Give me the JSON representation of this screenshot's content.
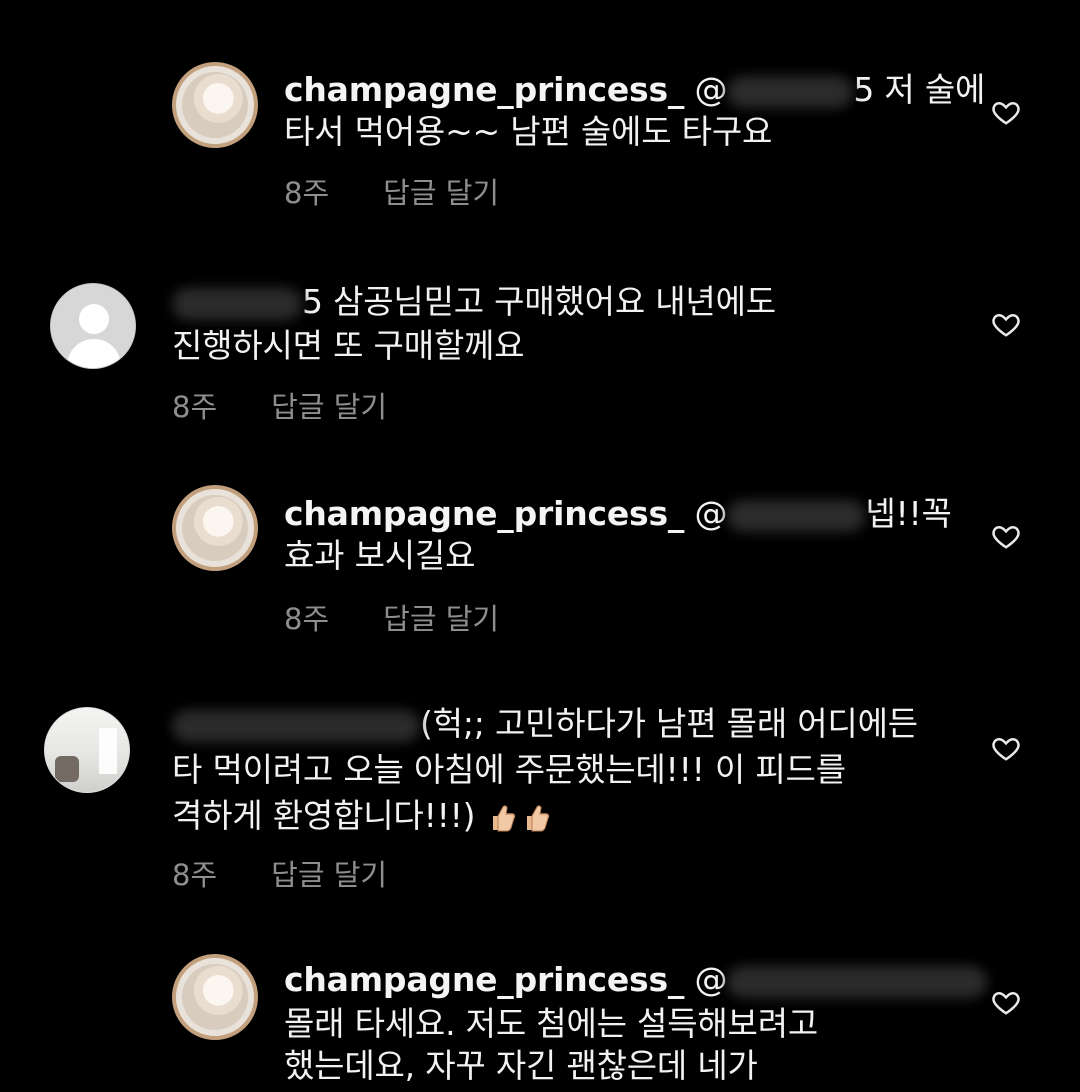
{
  "comments": [
    {
      "username": "champagne_princess_",
      "mention": "@",
      "line1_tail": "5 저 술에",
      "line2": "타서 먹어용~~ 남편 술에도 타구요",
      "time": "8주",
      "reply": "답글 달기",
      "heart_icon": "heart-outline-icon"
    },
    {
      "username": "",
      "line1_tail": "5 삼공님믿고 구매했어요 내년에도",
      "line2": "진행하시면 또 구매할께요",
      "time": "8주",
      "reply": "답글 달기",
      "heart_icon": "heart-outline-icon"
    },
    {
      "username": "champagne_princess_",
      "mention": "@",
      "line1_tail": "넵!!꼭",
      "line2": "효과 보시길요",
      "time": "8주",
      "reply": "답글 달기",
      "heart_icon": "heart-outline-icon"
    },
    {
      "username": "",
      "line1_tail": "(헉;; 고민하다가 남편 몰래 어디에든",
      "line2": "타 먹이려고 오늘 아침에 주문했는데!!! 이 피드를",
      "line3": "격하게 환영합니다!!!)",
      "emoji": "👍👍",
      "time": "8주",
      "reply": "답글 달기",
      "heart_icon": "heart-outline-icon"
    },
    {
      "username": "champagne_princess_",
      "mention": "@",
      "line2": "몰래 타세요. 저도 첨에는 설득해보려고",
      "line3": "했는데요, 자꾸 자긴 괜찮은데 네가",
      "heart_icon": "heart-outline-icon"
    }
  ]
}
